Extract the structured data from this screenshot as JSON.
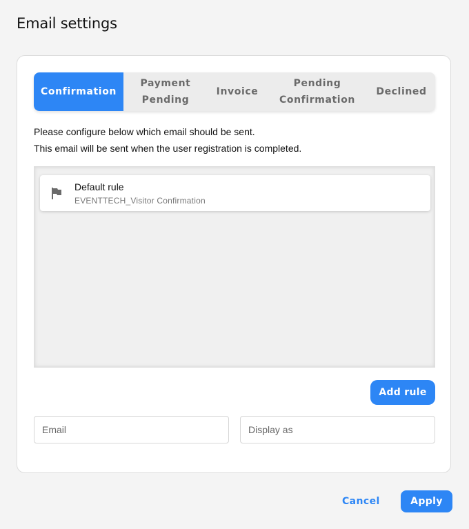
{
  "dialog": {
    "title": "Email settings"
  },
  "tabs": [
    {
      "label": "Confirmation",
      "active": true
    },
    {
      "label": "Payment Pending",
      "active": false
    },
    {
      "label": "Invoice",
      "active": false
    },
    {
      "label": "Pending Confirmation",
      "active": false
    },
    {
      "label": "Declined",
      "active": false
    }
  ],
  "description": {
    "line1": "Please configure below which email should be sent.",
    "line2": "This email will be sent when the user registration is completed."
  },
  "rules": [
    {
      "name": "Default rule",
      "template": "EVENTTECH_Visitor Confirmation",
      "icon": "flag-icon"
    }
  ],
  "add_rule_label": "Add rule",
  "fields": {
    "email": {
      "placeholder": "Email",
      "value": ""
    },
    "display_as": {
      "placeholder": "Display as",
      "value": ""
    }
  },
  "footer": {
    "cancel_label": "Cancel",
    "apply_label": "Apply"
  },
  "colors": {
    "accent": "#2d86f5",
    "tab_bg": "#ececec",
    "background": "#f4f4f4"
  }
}
